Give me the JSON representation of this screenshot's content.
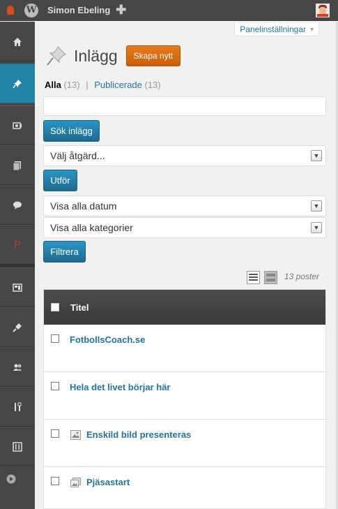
{
  "adminbar": {
    "user_name": "Simon Ebeling",
    "new_symbol": "✚"
  },
  "screen_options": {
    "label": "Panelinställningar"
  },
  "page": {
    "title": "Inlägg",
    "add_new": "Skapa nytt"
  },
  "filters_tabs": {
    "all_label": "Alla",
    "all_count": "(13)",
    "published_label": "Publicerade",
    "published_count": "(13)",
    "separator": "|"
  },
  "search": {
    "value": "",
    "button": "Sök inlägg"
  },
  "bulk_actions": {
    "selected": "Välj åtgärd...",
    "apply": "Utför"
  },
  "date_filter": {
    "selected": "Visa alla datum"
  },
  "category_filter": {
    "selected": "Visa alla kategorier"
  },
  "filter_button": "Filtrera",
  "item_count": "13 poster",
  "table": {
    "header_title": "Titel",
    "rows": [
      {
        "title": "FotbollsCoach.se",
        "format_icon": ""
      },
      {
        "title": "Hela det livet börjar här",
        "format_icon": ""
      },
      {
        "title": "Enskild bild presenteras",
        "format_icon": "image-icon"
      },
      {
        "title": "Pjäsastart",
        "format_icon": "gallery-icon"
      }
    ]
  },
  "menu": {
    "items": [
      "home-icon",
      "posts-pin-icon",
      "media-icon",
      "pages-icon",
      "comments-icon",
      "plugin-p-icon",
      "appearance-icon",
      "plugins-icon",
      "users-icon",
      "tools-icon",
      "settings-icon",
      "collapse-icon"
    ],
    "p_letter": "P"
  },
  "colors": {
    "adminbar": "#464646",
    "menu_active": "#2283a4",
    "primary_button": "#21759b",
    "add_new_button": "#d66b0f",
    "link": "#21759b",
    "table_header": "#414141"
  }
}
